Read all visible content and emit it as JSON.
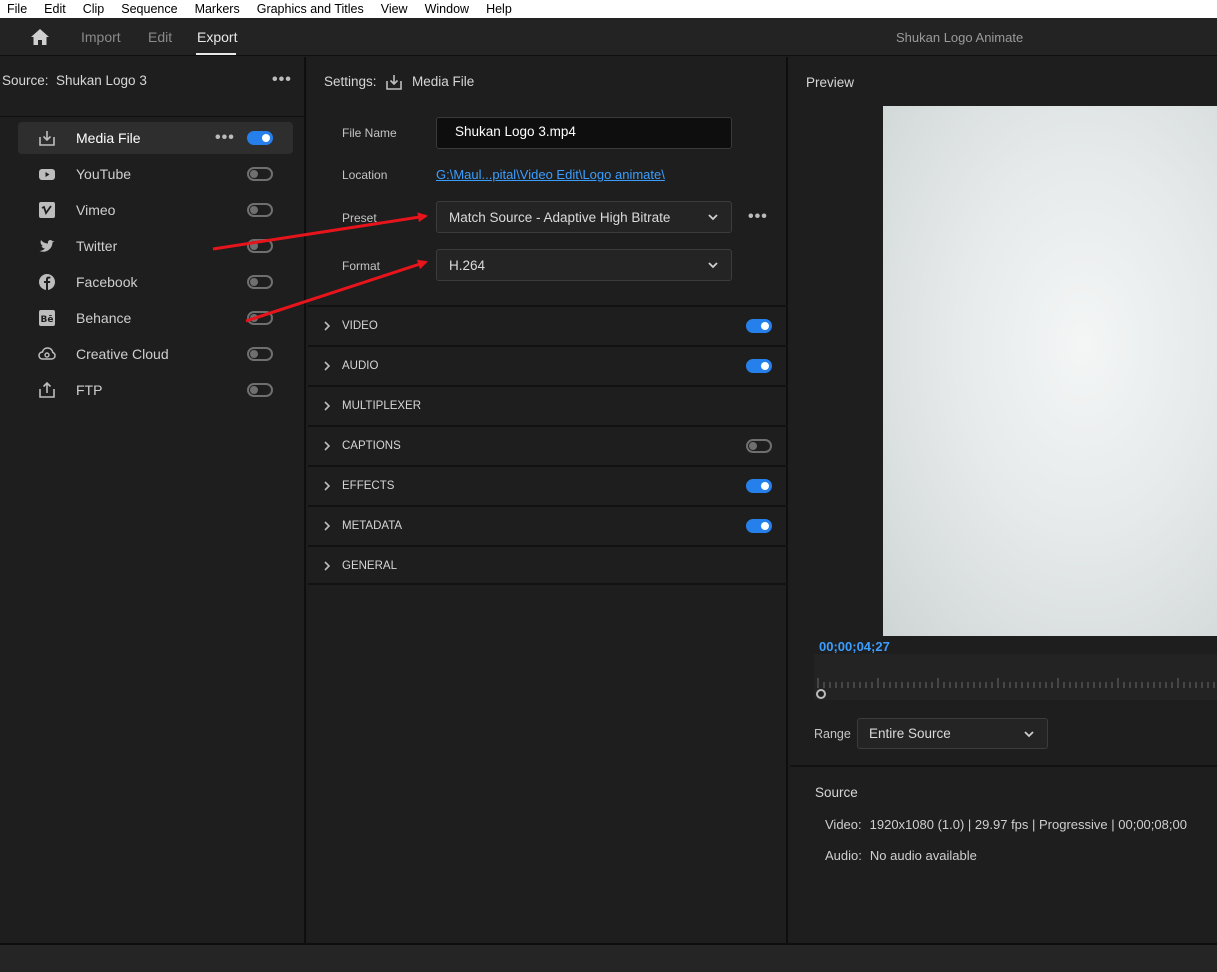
{
  "menu": [
    "File",
    "Edit",
    "Clip",
    "Sequence",
    "Markers",
    "Graphics and Titles",
    "View",
    "Window",
    "Help"
  ],
  "header": {
    "tabs": [
      {
        "label": "Import",
        "active": false
      },
      {
        "label": "Edit",
        "active": false
      },
      {
        "label": "Export",
        "active": true
      }
    ],
    "project_title": "Shukan Logo Animate"
  },
  "source": {
    "label": "Source:",
    "name": "Shukan Logo 3"
  },
  "destinations": [
    {
      "label": "Media File",
      "icon": "download-icon",
      "enabled": true,
      "selected": true
    },
    {
      "label": "YouTube",
      "icon": "youtube-icon",
      "enabled": false
    },
    {
      "label": "Vimeo",
      "icon": "vimeo-icon",
      "enabled": false
    },
    {
      "label": "Twitter",
      "icon": "twitter-icon",
      "enabled": false
    },
    {
      "label": "Facebook",
      "icon": "facebook-icon",
      "enabled": false
    },
    {
      "label": "Behance",
      "icon": "behance-icon",
      "enabled": false
    },
    {
      "label": "Creative Cloud",
      "icon": "creative-cloud-icon",
      "enabled": false
    },
    {
      "label": "FTP",
      "icon": "upload-icon",
      "enabled": false
    }
  ],
  "settings": {
    "label": "Settings:",
    "target": "Media File",
    "file_name_label": "File Name",
    "file_name": "Shukan Logo 3.mp4",
    "location_label": "Location",
    "location": "G:\\Maul...pital\\Video Edit\\Logo animate\\",
    "preset_label": "Preset",
    "preset": "Match Source - Adaptive High Bitrate",
    "format_label": "Format",
    "format": "H.264"
  },
  "sections": [
    {
      "label": "VIDEO",
      "has_toggle": true,
      "enabled": true
    },
    {
      "label": "AUDIO",
      "has_toggle": true,
      "enabled": true
    },
    {
      "label": "MULTIPLEXER",
      "has_toggle": false,
      "enabled": false
    },
    {
      "label": "CAPTIONS",
      "has_toggle": true,
      "enabled": false
    },
    {
      "label": "EFFECTS",
      "has_toggle": true,
      "enabled": true
    },
    {
      "label": "METADATA",
      "has_toggle": true,
      "enabled": true
    },
    {
      "label": "GENERAL",
      "has_toggle": false,
      "enabled": false
    }
  ],
  "preview": {
    "title": "Preview",
    "timecode": "00;00;04;27",
    "range_label": "Range",
    "range_value": "Entire Source"
  },
  "source_info": {
    "title": "Source",
    "video_label": "Video:",
    "video_value": "1920x1080 (1.0) | 29.97 fps | Progressive | 00;00;08;00",
    "audio_label": "Audio:",
    "audio_value": "No audio available"
  },
  "colors": {
    "accent": "#2680eb",
    "link": "#3b9eff",
    "annotation_arrow": "#e8141c"
  }
}
